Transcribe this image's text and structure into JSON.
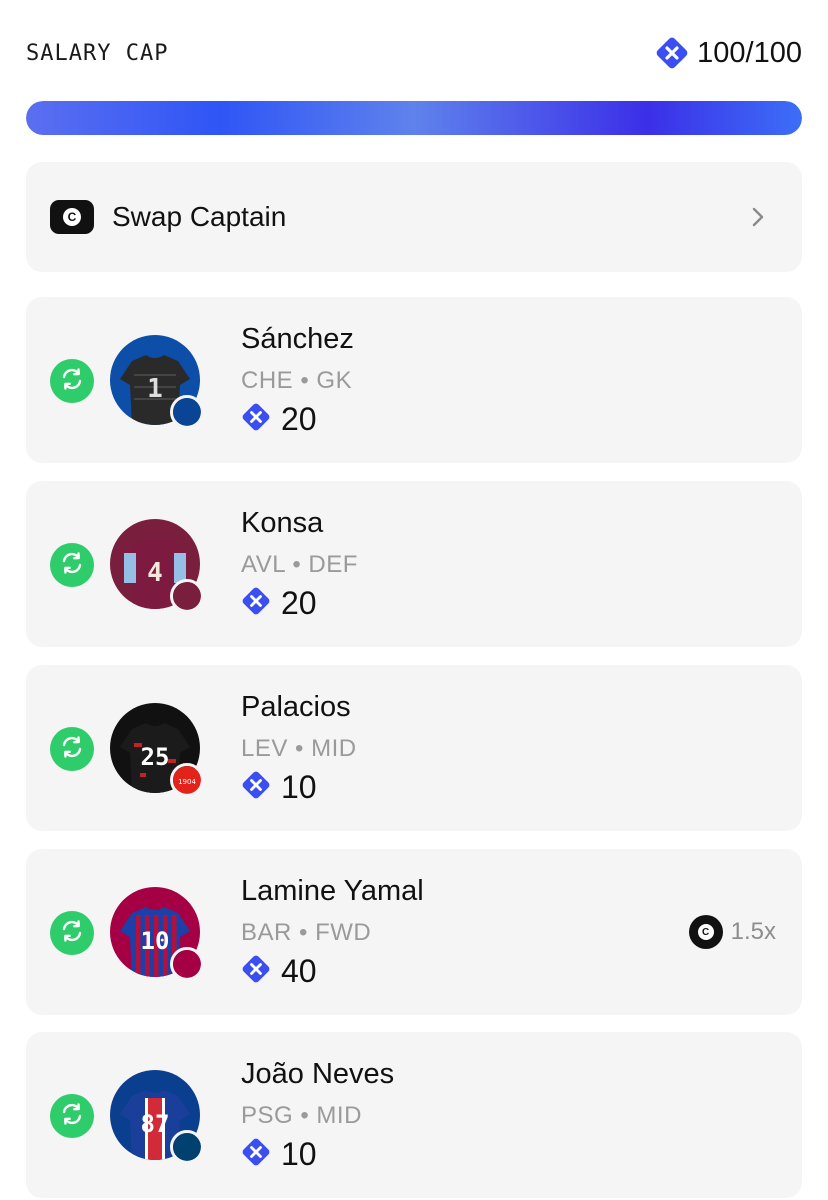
{
  "salary_cap": {
    "label": "SALARY CAP",
    "value": "100/100",
    "used": 100,
    "max": 100,
    "bar_fill_percent": 100
  },
  "captain_row": {
    "badge_letter": "C",
    "label": "Swap Captain",
    "icon": "chevron-right-icon"
  },
  "players": [
    {
      "name": "Sánchez",
      "club": "CHE",
      "position": "GK",
      "meta": "CHE • GK",
      "price": "20",
      "number": "1",
      "kit": "gk-black",
      "club_color": "#0a4595"
    },
    {
      "name": "Konsa",
      "club": "AVL",
      "position": "DEF",
      "meta": "AVL • DEF",
      "price": "20",
      "number": "4",
      "kit": "claret",
      "club_color": "#7a1e3e"
    },
    {
      "name": "Palacios",
      "club": "LEV",
      "position": "MID",
      "meta": "LEV • MID",
      "price": "10",
      "number": "25",
      "kit": "black-red",
      "club_color": "#e32219",
      "badge_text": "1904"
    },
    {
      "name": "Lamine Yamal",
      "club": "BAR",
      "position": "FWD",
      "meta": "BAR • FWD",
      "price": "40",
      "number": "10",
      "kit": "blaugrana",
      "club_color": "#a50044",
      "captain_badge": "C",
      "multiplier": "1.5x"
    },
    {
      "name": "João Neves",
      "club": "PSG",
      "position": "MID",
      "meta": "PSG • MID",
      "price": "10",
      "number": "87",
      "kit": "psg",
      "club_color": "#004170"
    }
  ],
  "colors": {
    "accent_blue": "#3b4ef2",
    "swap_green": "#2ecc6a",
    "card_bg": "#f5f5f5"
  }
}
